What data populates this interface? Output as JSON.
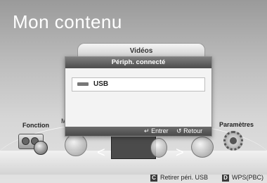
{
  "screen": {
    "title": "Mon contenu"
  },
  "categories": {
    "left": "Fonction",
    "right": "Paramètres",
    "left_letter": "M",
    "right_letter": "s"
  },
  "dialog": {
    "tab_label": "Vidéos",
    "header": "Périph. connecté",
    "items": [
      {
        "label": "USB",
        "icon": "usb-stick-icon"
      }
    ],
    "footer": {
      "enter": "Entrer",
      "back": "Retour"
    }
  },
  "bottom_bar": {
    "hints": [
      {
        "key": "C",
        "label": "Retirer péri. USB"
      },
      {
        "key": "D",
        "label": "WPS(PBC)"
      }
    ]
  }
}
